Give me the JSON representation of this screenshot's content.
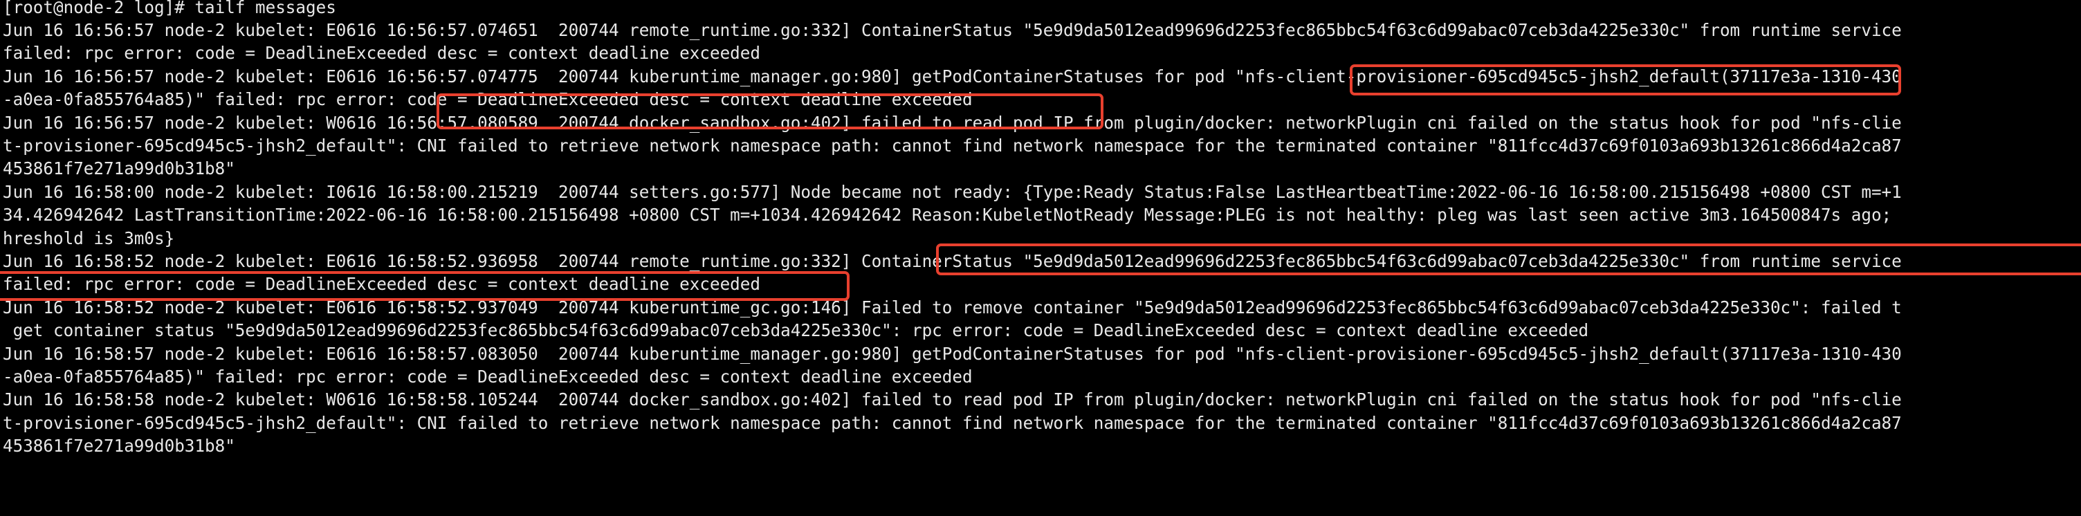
{
  "terminal": {
    "lines": [
      "[root@node-2 log]# tailf messages",
      "Jun 16 16:56:57 node-2 kubelet: E0616 16:56:57.074651  200744 remote_runtime.go:332] ContainerStatus \"5e9d9da5012ead99696d2253fec865bbc54f63c6d99abac07ceb3da4225e330c\" from runtime service",
      "failed: rpc error: code = DeadlineExceeded desc = context deadline exceeded",
      "Jun 16 16:56:57 node-2 kubelet: E0616 16:56:57.074775  200744 kuberuntime_manager.go:980] getPodContainerStatuses for pod \"nfs-client-provisioner-695cd945c5-jhsh2_default(37117e3a-1310-430",
      "-a0ea-0fa855764a85)\" failed: rpc error: code = DeadlineExceeded desc = context deadline exceeded",
      "Jun 16 16:56:57 node-2 kubelet: W0616 16:56:57.080589  200744 docker_sandbox.go:402] failed to read pod IP from plugin/docker: networkPlugin cni failed on the status hook for pod \"nfs-clie",
      "t-provisioner-695cd945c5-jhsh2_default\": CNI failed to retrieve network namespace path: cannot find network namespace for the terminated container \"811fcc4d37c69f0103a693b13261c866d4a2ca87",
      "453861f7e271a99d0b31b8\"",
      "Jun 16 16:58:00 node-2 kubelet: I0616 16:58:00.215219  200744 setters.go:577] Node became not ready: {Type:Ready Status:False LastHeartbeatTime:2022-06-16 16:58:00.215156498 +0800 CST m=+1",
      "34.426942642 LastTransitionTime:2022-06-16 16:58:00.215156498 +0800 CST m=+1034.426942642 Reason:KubeletNotReady Message:PLEG is not healthy: pleg was last seen active 3m3.164500847s ago;",
      "hreshold is 3m0s}",
      "Jun 16 16:58:52 node-2 kubelet: E0616 16:58:52.936958  200744 remote_runtime.go:332] ContainerStatus \"5e9d9da5012ead99696d2253fec865bbc54f63c6d99abac07ceb3da4225e330c\" from runtime service",
      "failed: rpc error: code = DeadlineExceeded desc = context deadline exceeded",
      "Jun 16 16:58:52 node-2 kubelet: E0616 16:58:52.937049  200744 kuberuntime_gc.go:146] Failed to remove container \"5e9d9da5012ead99696d2253fec865bbc54f63c6d99abac07ceb3da4225e330c\": failed t",
      " get container status \"5e9d9da5012ead99696d2253fec865bbc54f63c6d99abac07ceb3da4225e330c\": rpc error: code = DeadlineExceeded desc = context deadline exceeded",
      "Jun 16 16:58:57 node-2 kubelet: E0616 16:58:57.083050  200744 kuberuntime_manager.go:980] getPodContainerStatuses for pod \"nfs-client-provisioner-695cd945c5-jhsh2_default(37117e3a-1310-430",
      "-a0ea-0fa855764a85)\" failed: rpc error: code = DeadlineExceeded desc = context deadline exceeded",
      "Jun 16 16:58:58 node-2 kubelet: W0616 16:58:58.105244  200744 docker_sandbox.go:402] failed to read pod IP from plugin/docker: networkPlugin cni failed on the status hook for pod \"nfs-clie",
      "t-provisioner-695cd945c5-jhsh2_default\": CNI failed to retrieve network namespace path: cannot find network namespace for the terminated container \"811fcc4d37c69f0103a693b13261c866d4a2ca87",
      "453861f7e271a99d0b31b8\""
    ]
  },
  "colors": {
    "background": "#000000",
    "text": "#e8e8e8",
    "highlight": "#e8402e"
  }
}
